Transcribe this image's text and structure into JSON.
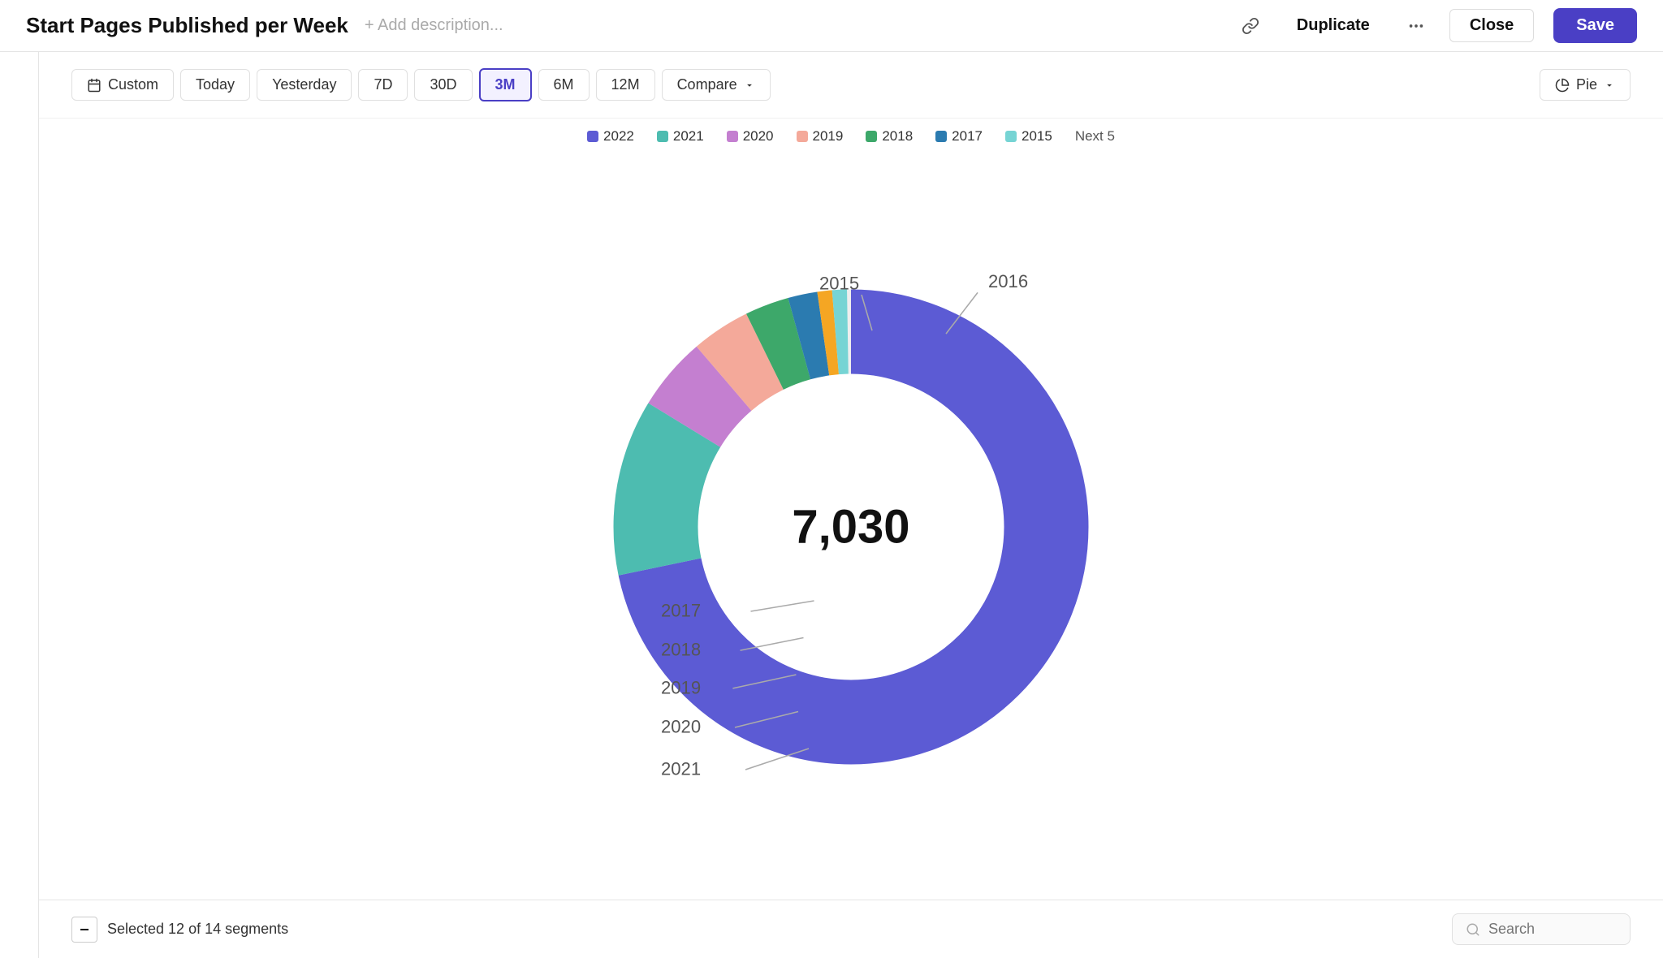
{
  "header": {
    "title": "Start Pages Published per Week",
    "add_description": "+ Add description...",
    "duplicate_label": "Duplicate",
    "close_label": "Close",
    "save_label": "Save"
  },
  "filters": {
    "custom_label": "Custom",
    "today_label": "Today",
    "yesterday_label": "Yesterday",
    "7d_label": "7D",
    "30d_label": "30D",
    "3m_label": "3M",
    "6m_label": "6M",
    "12m_label": "12M",
    "compare_label": "Compare",
    "pie_label": "Pie"
  },
  "legend": {
    "items": [
      {
        "label": "2022",
        "color": "#5C5BD4"
      },
      {
        "label": "2021",
        "color": "#4DBCB0"
      },
      {
        "label": "2020",
        "color": "#C47FD0"
      },
      {
        "label": "2019",
        "color": "#F4A99A"
      },
      {
        "label": "2018",
        "color": "#3DA86A"
      },
      {
        "label": "2017",
        "color": "#2B7BB0"
      },
      {
        "label": "2015",
        "color": "#76D4D4"
      }
    ],
    "next_label": "Next 5"
  },
  "chart": {
    "center_value": "7,030",
    "segments": [
      {
        "label": "2022",
        "color": "#5C5BD4",
        "percentage": 72
      },
      {
        "label": "2021",
        "color": "#4DBCB0",
        "percentage": 12
      },
      {
        "label": "2020",
        "color": "#C47FD0",
        "percentage": 5
      },
      {
        "label": "2019",
        "color": "#F4A99A",
        "percentage": 4
      },
      {
        "label": "2018",
        "color": "#3DA86A",
        "percentage": 3
      },
      {
        "label": "2017",
        "color": "#2B7BB0",
        "percentage": 2
      },
      {
        "label": "2016",
        "color": "#F5A623",
        "percentage": 1
      },
      {
        "label": "2015",
        "color": "#76D4D4",
        "percentage": 1
      }
    ]
  },
  "bottom": {
    "selected_text": "Selected 12 of 14 segments",
    "search_placeholder": "Search"
  }
}
